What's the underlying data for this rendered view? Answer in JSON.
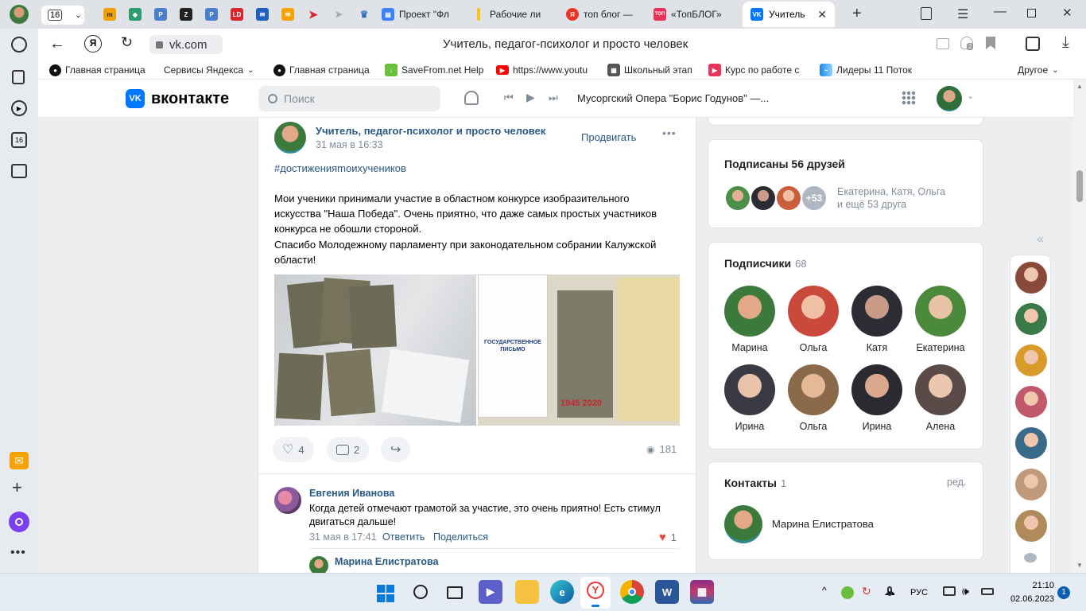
{
  "browser": {
    "tab_counter": "16",
    "tabs": [
      {
        "label": "Проект \"Фл",
        "icon": "doc-icon",
        "color": "#3b82f6"
      },
      {
        "label": "Рабочие ли",
        "icon": "note-icon",
        "color": "#f5c518"
      },
      {
        "label": "топ блог —",
        "icon": "yandex-icon",
        "color": "#ef3124"
      },
      {
        "label": "«ТопБЛОГ»",
        "icon": "topblog-icon",
        "color": "#e8335a"
      },
      {
        "label": "Учитель",
        "icon": "vk-icon",
        "color": "#0077ff"
      }
    ],
    "page_title": "Учитель, педагог-психолог и просто человек",
    "address": "vk.com",
    "downloads_badge": "2"
  },
  "bookmarks": {
    "items": [
      {
        "label": "Главная страница",
        "icon": "github-icon"
      },
      {
        "label": "Сервисы Яндекса",
        "icon": "dropdown"
      },
      {
        "label": "Главная страница",
        "icon": "github-icon"
      },
      {
        "label": "SaveFrom.net Help",
        "icon": "download-icon"
      },
      {
        "label": "https://www.youtu",
        "icon": "youtube-icon"
      },
      {
        "label": "Школьный этап",
        "icon": "table-icon"
      },
      {
        "label": "Курс по работе с",
        "icon": "course-icon"
      },
      {
        "label": "Лидеры 11 Поток",
        "icon": "wave-icon"
      }
    ],
    "other": "Другое"
  },
  "vk_header": {
    "logo": "вконтакте",
    "search_placeholder": "Поиск",
    "player_track": "Мусоргский Опера \"Борис Годунов\" —..."
  },
  "post": {
    "author": "Учитель, педагог-психолог и просто человек",
    "date": "31 мая в 16:33",
    "promote": "Продвигать",
    "hashtag": "#достиженияmoихучеников",
    "text": "Мои ученики принимали участие в областном конкурсе изобразительного искусства \"Наша Победа\". Очень приятно, что даже самых простых участников конкурса не обошли стороной.\nСпасибо Молодежному парламенту при законодательном собрании Калужской области!",
    "likes": "4",
    "comments": "2",
    "views": "181",
    "photo2_caption": "1945 2020",
    "photo2_heading": "ГОСУДАРСТВЕННОЕ ПИСЬМО"
  },
  "comments": [
    {
      "author": "Евгения Иванова",
      "text": "Когда детей отмечают грамотой за участие, это очень приятно! Есть стимул двигаться дальше!",
      "date": "31 мая в 17:41",
      "reply": "Ответить",
      "share": "Поделиться",
      "likes": "1"
    },
    {
      "author": "Марина Елистратова"
    }
  ],
  "friends_card": {
    "title": "Подписаны 56 друзей",
    "more": "+53",
    "names": "Екатерина, Катя, Ольга",
    "and_more": "и ещё 53 друга"
  },
  "followers_card": {
    "title": "Подписчики",
    "count": "68",
    "people": [
      {
        "name": "Марина"
      },
      {
        "name": "Ольга"
      },
      {
        "name": "Катя"
      },
      {
        "name": "Екатерина"
      },
      {
        "name": "Ирина"
      },
      {
        "name": "Ольга"
      },
      {
        "name": "Ирина"
      },
      {
        "name": "Алена"
      }
    ]
  },
  "contacts_card": {
    "title": "Контакты",
    "count": "1",
    "edit": "ред.",
    "name": "Марина Елистратова"
  },
  "taskbar": {
    "lang": "РУС",
    "time": "21:10",
    "date": "02.06.2023",
    "notif": "1"
  },
  "colors": {
    "vk_blue": "#0077ff",
    "link": "#2a5885",
    "heart": "#e64646"
  }
}
